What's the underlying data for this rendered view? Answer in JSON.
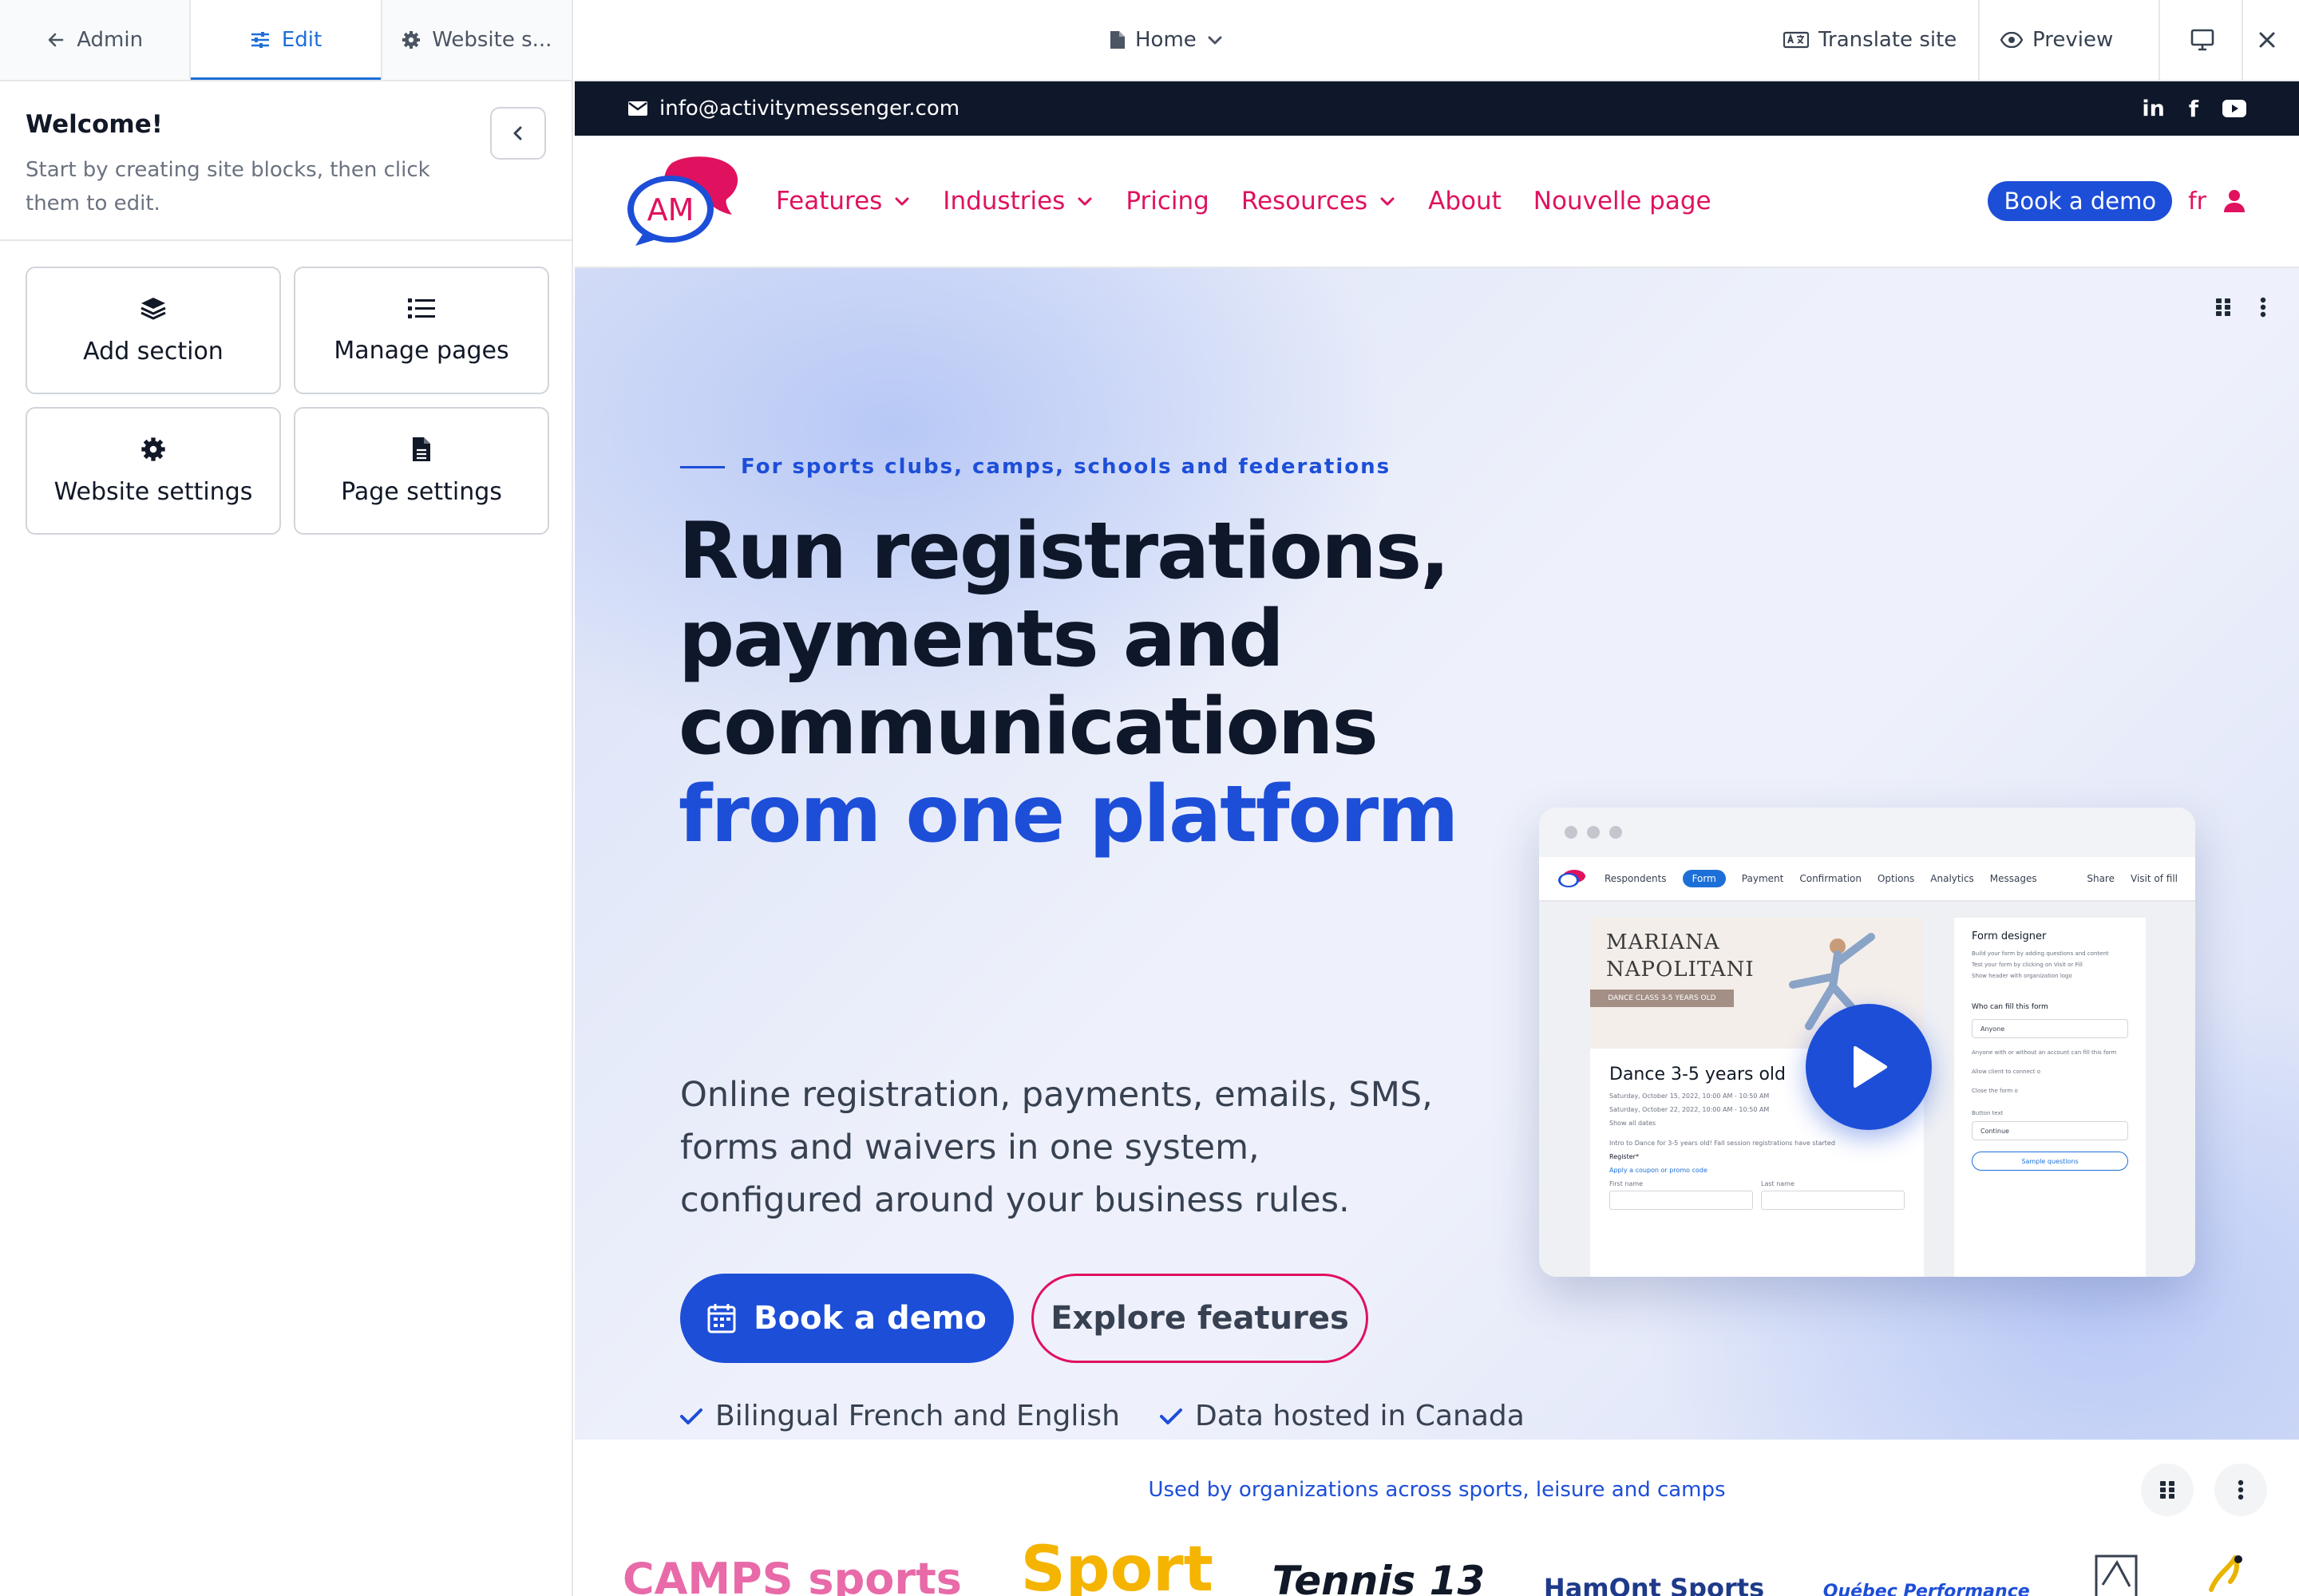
{
  "editor": {
    "tabs": [
      {
        "label": "Admin"
      },
      {
        "label": "Edit"
      },
      {
        "label": "Website s..."
      }
    ],
    "welcome": {
      "title": "Welcome!",
      "text": "Start by creating site blocks, then click them to edit."
    },
    "tiles": [
      {
        "label": "Add section"
      },
      {
        "label": "Manage pages"
      },
      {
        "label": "Website settings"
      },
      {
        "label": "Page settings"
      }
    ]
  },
  "topbar": {
    "page_selector": "Home",
    "translate": "Translate site",
    "preview": "Preview"
  },
  "site": {
    "email": "info@activitymessenger.com",
    "logo_text": "AM",
    "nav": {
      "features": "Features",
      "industries": "Industries",
      "pricing": "Pricing",
      "resources": "Resources",
      "about": "About",
      "new_page": "Nouvelle page",
      "book_demo": "Book a demo",
      "lang": "fr"
    },
    "hero": {
      "eyebrow": "For sports clubs, camps, schools and federations",
      "title_line1": "Run registrations,",
      "title_line2": "payments and",
      "title_line3": "communications",
      "title_accent": "from one platform",
      "subtitle": "Online registration, payments, emails, SMS, forms and waivers in one system, configured around your business rules.",
      "primary_cta": "Book a demo",
      "secondary_cta": "Explore features",
      "check1": "Bilingual French and English",
      "check2": "Data hosted in Canada"
    },
    "mockup": {
      "tabs": [
        "Respondents",
        "Form",
        "Payment",
        "Confirmation",
        "Options",
        "Analytics",
        "Messages"
      ],
      "share": "Share",
      "visit": "Visit of fill",
      "banner_name_1": "MARIANA",
      "banner_name_2": "NAPOLITANI",
      "banner_tag": "DANCE CLASS 3-5 YEARS OLD",
      "event_title": "Dance 3-5 years old",
      "date1": "Saturday, October 15, 2022, 10:00 AM - 10:50 AM",
      "date2": "Saturday, October 22, 2022, 10:00 AM - 10:50 AM",
      "show_dates": "Show all dates",
      "intro": "Intro to Dance for 3-5 years old! Fall session registrations have started",
      "register": "Register*",
      "coupon": "Apply a coupon or promo code",
      "first_name": "First name",
      "last_name": "Last name",
      "designer_title": "Form designer",
      "designer_tip1": "Build your form by adding questions and content",
      "designer_tip2": "Test your form by clicking on Visit or Fill",
      "show_header": "Show header with organization logo",
      "who_fill": "Who can fill this form",
      "anyone": "Anyone",
      "who_note": "Anyone with or without an account can fill this form",
      "allow_connect": "Allow client to connect o",
      "close_form": "Close the form o",
      "button_text": "Button text",
      "continue": "Continue",
      "sample": "Sample questions"
    },
    "logos": {
      "title": "Used by organizations across sports, leisure and camps",
      "items": [
        {
          "name": "CAMPS sports"
        },
        {
          "name": "Sport"
        },
        {
          "name": "Tennis 13"
        },
        {
          "name": "HamOnt Sports"
        },
        {
          "name": "Québec Performance"
        }
      ]
    },
    "colors": {
      "brand_pink": "#e0115f",
      "brand_blue": "#1d4ed8",
      "dark": "#0f172a"
    }
  }
}
